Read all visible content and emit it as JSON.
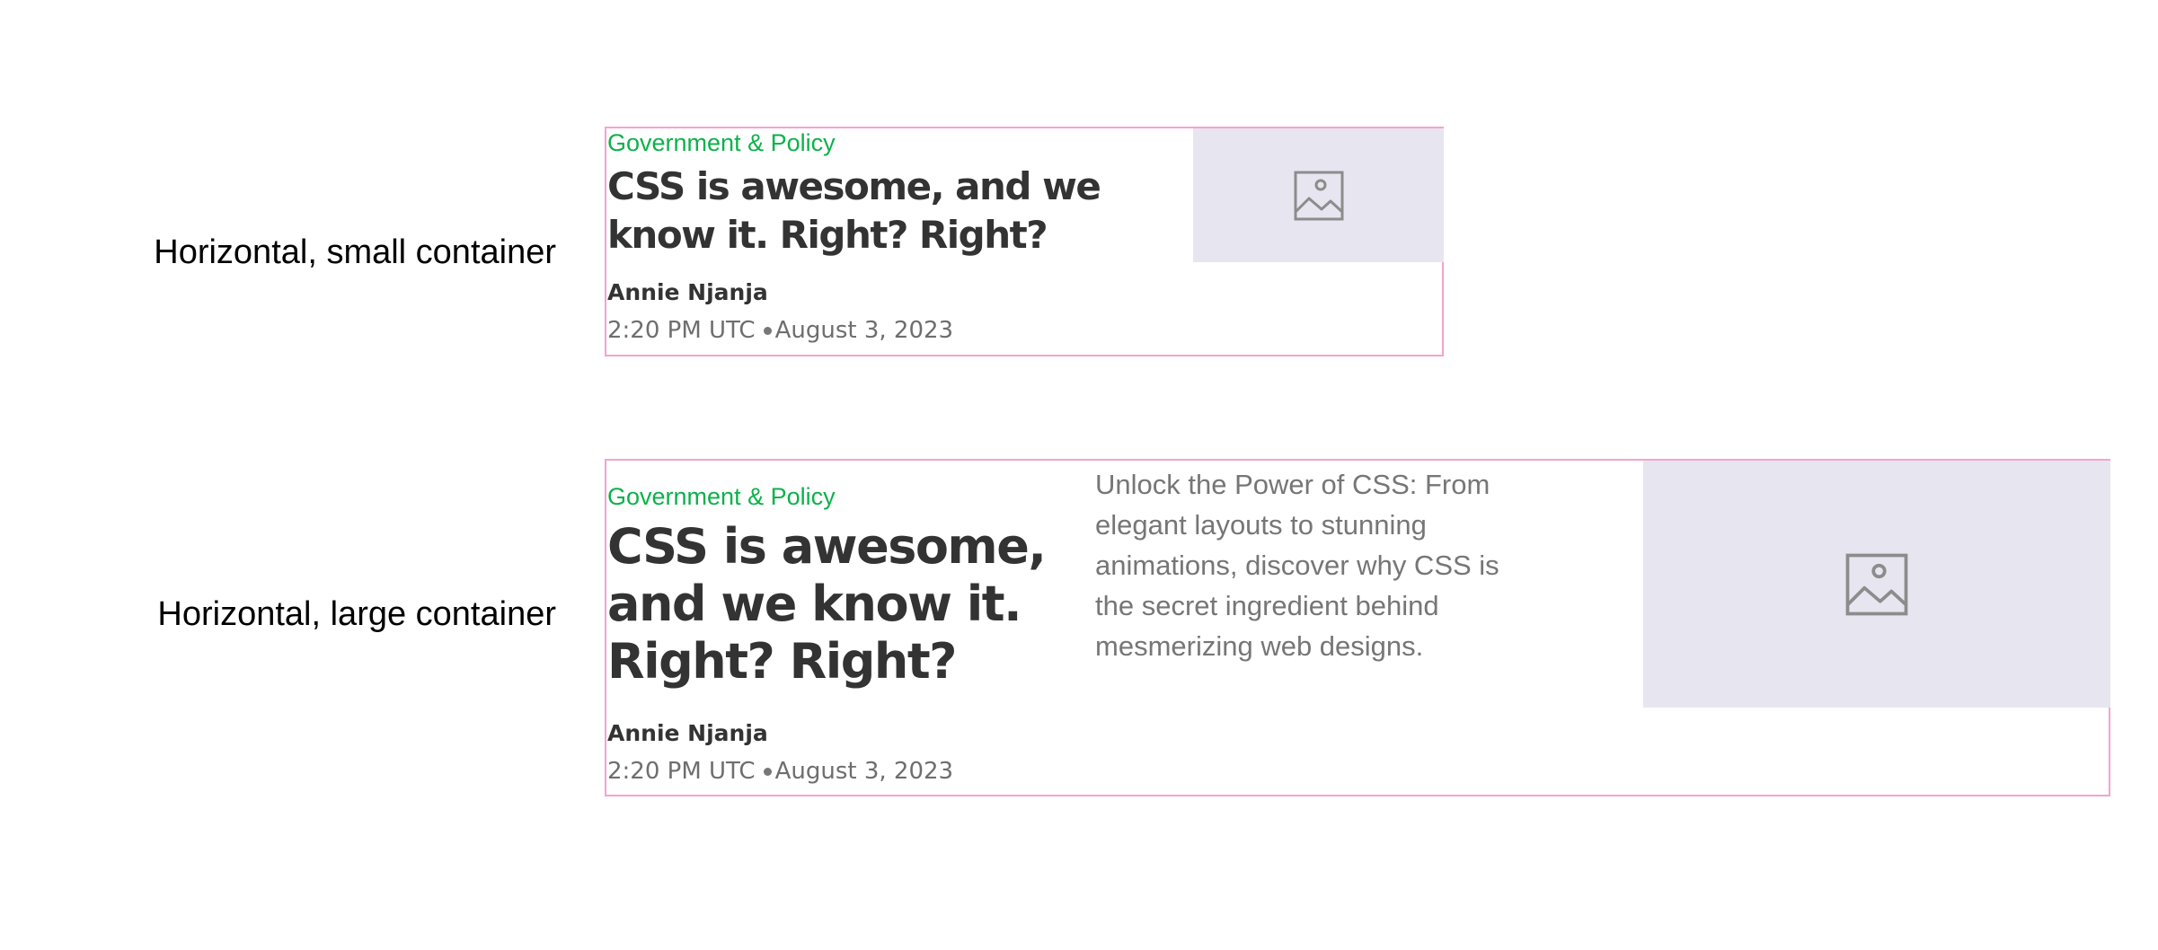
{
  "rows": [
    {
      "label": "Horizontal, small container",
      "card": {
        "category": "Government & Policy",
        "headline": "CSS is awesome, and we know it. Right? Right?",
        "author": "Annie Njanja",
        "time": "2:20 PM UTC",
        "date": "August 3, 2023",
        "image_icon": "image-placeholder-icon"
      }
    },
    {
      "label": "Horizontal, large container",
      "card": {
        "category": "Government & Policy",
        "headline": "CSS is awesome, and we know it. Right? Right?",
        "excerpt": "Unlock the Power of CSS: From elegant layouts to stunning animations, discover why CSS is the secret ingredient behind mesmerizing web designs.",
        "author": "Annie Njanja",
        "time": "2:20 PM UTC",
        "date": "August 3, 2023",
        "image_icon": "image-placeholder-icon"
      }
    }
  ],
  "colors": {
    "card_border": "#f4a3d0",
    "category": "#0bb24a",
    "headline": "#333333",
    "meta": "#6e6e6e",
    "image_placeholder_bg": "#e7e5ef"
  }
}
